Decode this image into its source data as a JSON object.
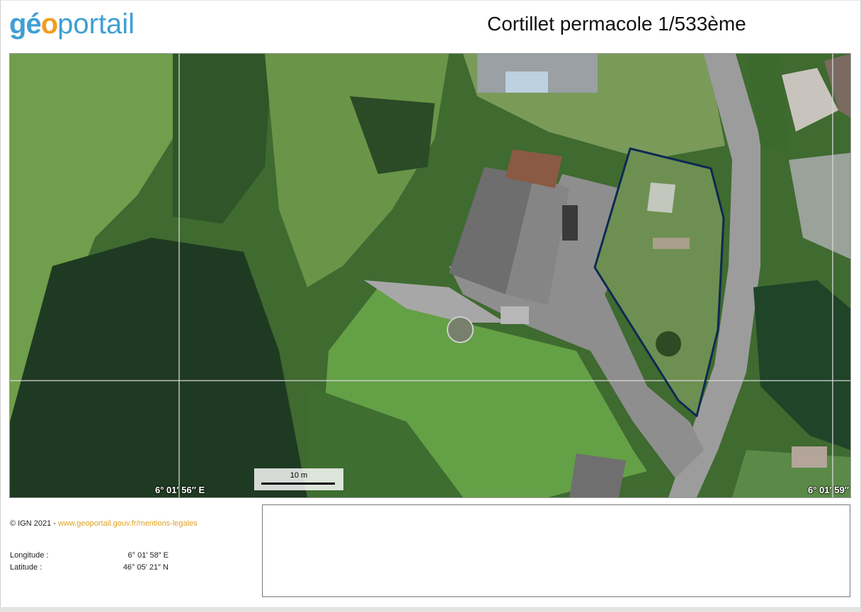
{
  "header": {
    "logo": {
      "part1": "g",
      "part2": "é",
      "part3": "o",
      "part4": "portail"
    },
    "title": "Cortillet permacole 1/533ème"
  },
  "map": {
    "graticule_labels": {
      "lon_left": "6° 01′ 56″ E",
      "lon_right": "6° 01′ 59″"
    },
    "scale_label": "10 m",
    "colors": {
      "parcel_outline": "#0d2a52",
      "grid": "#d8d8d8"
    }
  },
  "footer": {
    "credits_prefix": "© IGN 2021 - ",
    "credits_link": "www.geoportail.gouv.fr/mentions-legales",
    "longitude_label": "Longitude :",
    "longitude_value": "6° 01′ 58″ E",
    "latitude_label": "Latitude :",
    "latitude_value": "46° 05′ 21″ N"
  }
}
